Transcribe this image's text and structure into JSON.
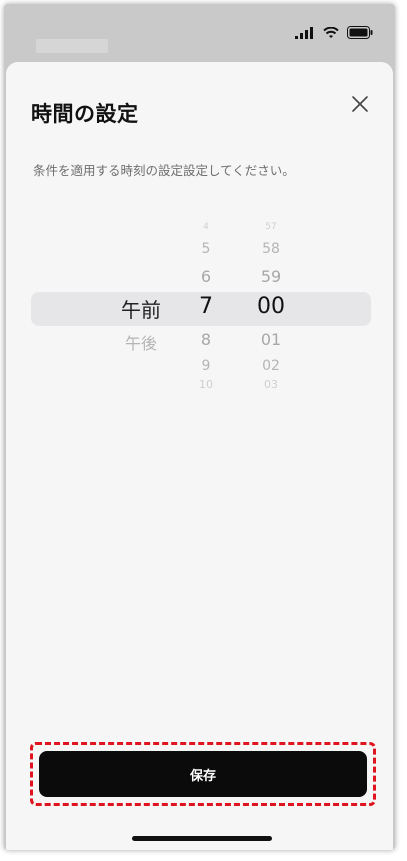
{
  "status_bar": {
    "icons": [
      "signal-icon",
      "wifi-icon",
      "battery-icon"
    ]
  },
  "sheet": {
    "title": "時間の設定",
    "description": "条件を適用する時刻の設定設定してください。",
    "close_icon": "close-icon"
  },
  "picker": {
    "ampm": {
      "selected": "午前",
      "after": [
        "午後"
      ]
    },
    "hour": {
      "before": [
        "4",
        "5",
        "6"
      ],
      "selected": "7",
      "after": [
        "8",
        "9",
        "10"
      ]
    },
    "minute": {
      "before": [
        "57",
        "58",
        "59"
      ],
      "selected": "00",
      "after": [
        "01",
        "02",
        "03"
      ]
    }
  },
  "save_button": {
    "label": "保存"
  },
  "colors": {
    "sheet_bg": "#f6f6f6",
    "button_bg": "#0b0b0b",
    "highlight_border": "#e0141e",
    "selection_band": "#e6e6e9"
  }
}
